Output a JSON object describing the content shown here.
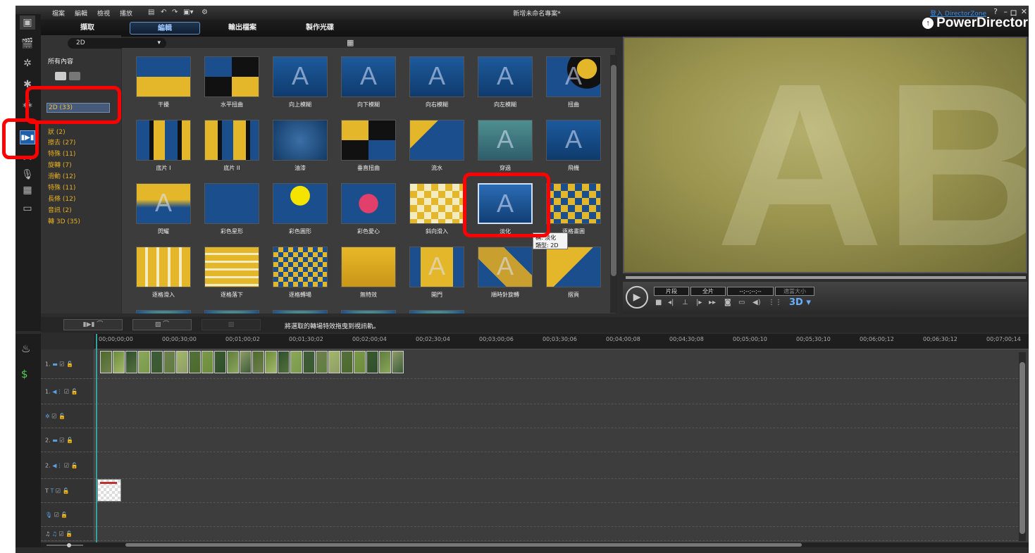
{
  "menu": [
    "檔案",
    "編輯",
    "檢視",
    "播放"
  ],
  "window_title": "新增未命名專案*",
  "directorzone_link": "登入 DirectorZone",
  "window_controls": [
    "?",
    "–",
    "ロ",
    "✕"
  ],
  "tabs": [
    "擷取",
    "編輯",
    "輸出檔案",
    "製作光碟"
  ],
  "active_tab": "編輯",
  "brand": "PowerDirector",
  "category_dropdown": "2D",
  "category_header": "所有內容",
  "categories": [
    {
      "label": "2D (33)",
      "selected": true
    },
    {
      "label": "狀 (2)"
    },
    {
      "label": "擦去 (27)"
    },
    {
      "label": "特殊 (11)"
    },
    {
      "label": "旋轉 (7)"
    },
    {
      "label": "滑動 (12)"
    },
    {
      "label": "特殊 (11)"
    },
    {
      "label": "長條 (12)"
    },
    {
      "label": "音訊 (2)"
    },
    {
      "label": "轉 3D (35)"
    }
  ],
  "transitions": [
    {
      "label": "干擾"
    },
    {
      "label": "水平扭曲"
    },
    {
      "label": "向上模糊"
    },
    {
      "label": "向下模糊"
    },
    {
      "label": "向右模糊"
    },
    {
      "label": "向左模糊"
    },
    {
      "label": "扭曲"
    },
    {
      "label": "底片 I"
    },
    {
      "label": "底片 II"
    },
    {
      "label": "油漆"
    },
    {
      "label": "垂直扭曲"
    },
    {
      "label": "流水"
    },
    {
      "label": "穿過"
    },
    {
      "label": "飛機"
    },
    {
      "label": "閃耀"
    },
    {
      "label": "彩色星形"
    },
    {
      "label": "彩色圓形"
    },
    {
      "label": "彩色愛心"
    },
    {
      "label": "斜向滑入"
    },
    {
      "label": "淡化",
      "selected": true
    },
    {
      "label": "逐格畫圓"
    },
    {
      "label": "逐格滑入"
    },
    {
      "label": "逐格落下"
    },
    {
      "label": "逐格轉場"
    },
    {
      "label": "無特效"
    },
    {
      "label": "開門"
    },
    {
      "label": "順時針旋轉"
    },
    {
      "label": "摺頁"
    }
  ],
  "tooltip": {
    "line1": "稱: 淡化",
    "line2": "類型: 2D"
  },
  "player": {
    "segment": "片段",
    "full": "全片",
    "timecode": "--;--;--;--",
    "size": "適當大小",
    "mode_3d": "3D"
  },
  "timeline": {
    "hint": "將選取的轉場特效拖曳到視訊軌。",
    "ruler": [
      "00;00;00;00",
      "00;00;30;00",
      "00;01;00;02",
      "00;01;30;02",
      "00;02;00;04",
      "00;02;30;04",
      "00;03;00;06",
      "00;03;30;06",
      "00;04;00;08",
      "00;04;30;08",
      "00;05;00;10",
      "00;05;30;10",
      "00;06;00;12",
      "00;06;30;12",
      "00;07;00;14"
    ],
    "tracks": [
      "1.",
      "1.",
      "",
      "2.",
      "2.",
      "T",
      "",
      "♫"
    ]
  },
  "colors": {
    "accent": "#1d5fa8",
    "category_text": "#e8b023",
    "highlight": "#ff0000"
  }
}
